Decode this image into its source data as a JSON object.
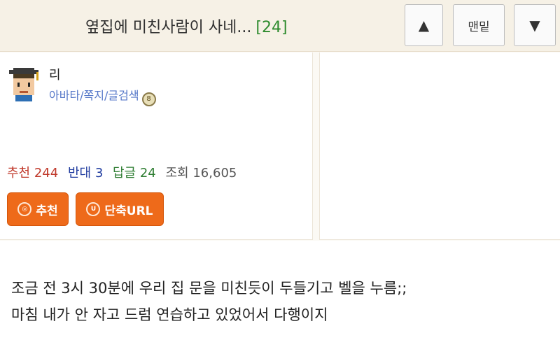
{
  "header": {
    "title": "옆집에 미친사람이 사네...",
    "reply_count": "[24]",
    "up_label": "▲",
    "bottom_label": "맨밑",
    "down_label": "▼"
  },
  "author": {
    "name": "리",
    "links": "아바타/쪽지/글검색"
  },
  "stats": {
    "recommend_label": "추천",
    "recommend_value": "244",
    "oppose_label": "반대",
    "oppose_value": "3",
    "replies_label": "답글",
    "replies_value": "24",
    "views_label": "조회",
    "views_value": "16,605"
  },
  "actions": {
    "recommend_label": "추천",
    "short_url_label": "단축URL"
  },
  "post": {
    "lines": [
      "조금 전 3시 30분에 우리 집 문을 미친듯이 두들기고 벨을 누름;;",
      "마침 내가 안 자고 드럼 연습하고 있었어서 다행이지"
    ]
  }
}
